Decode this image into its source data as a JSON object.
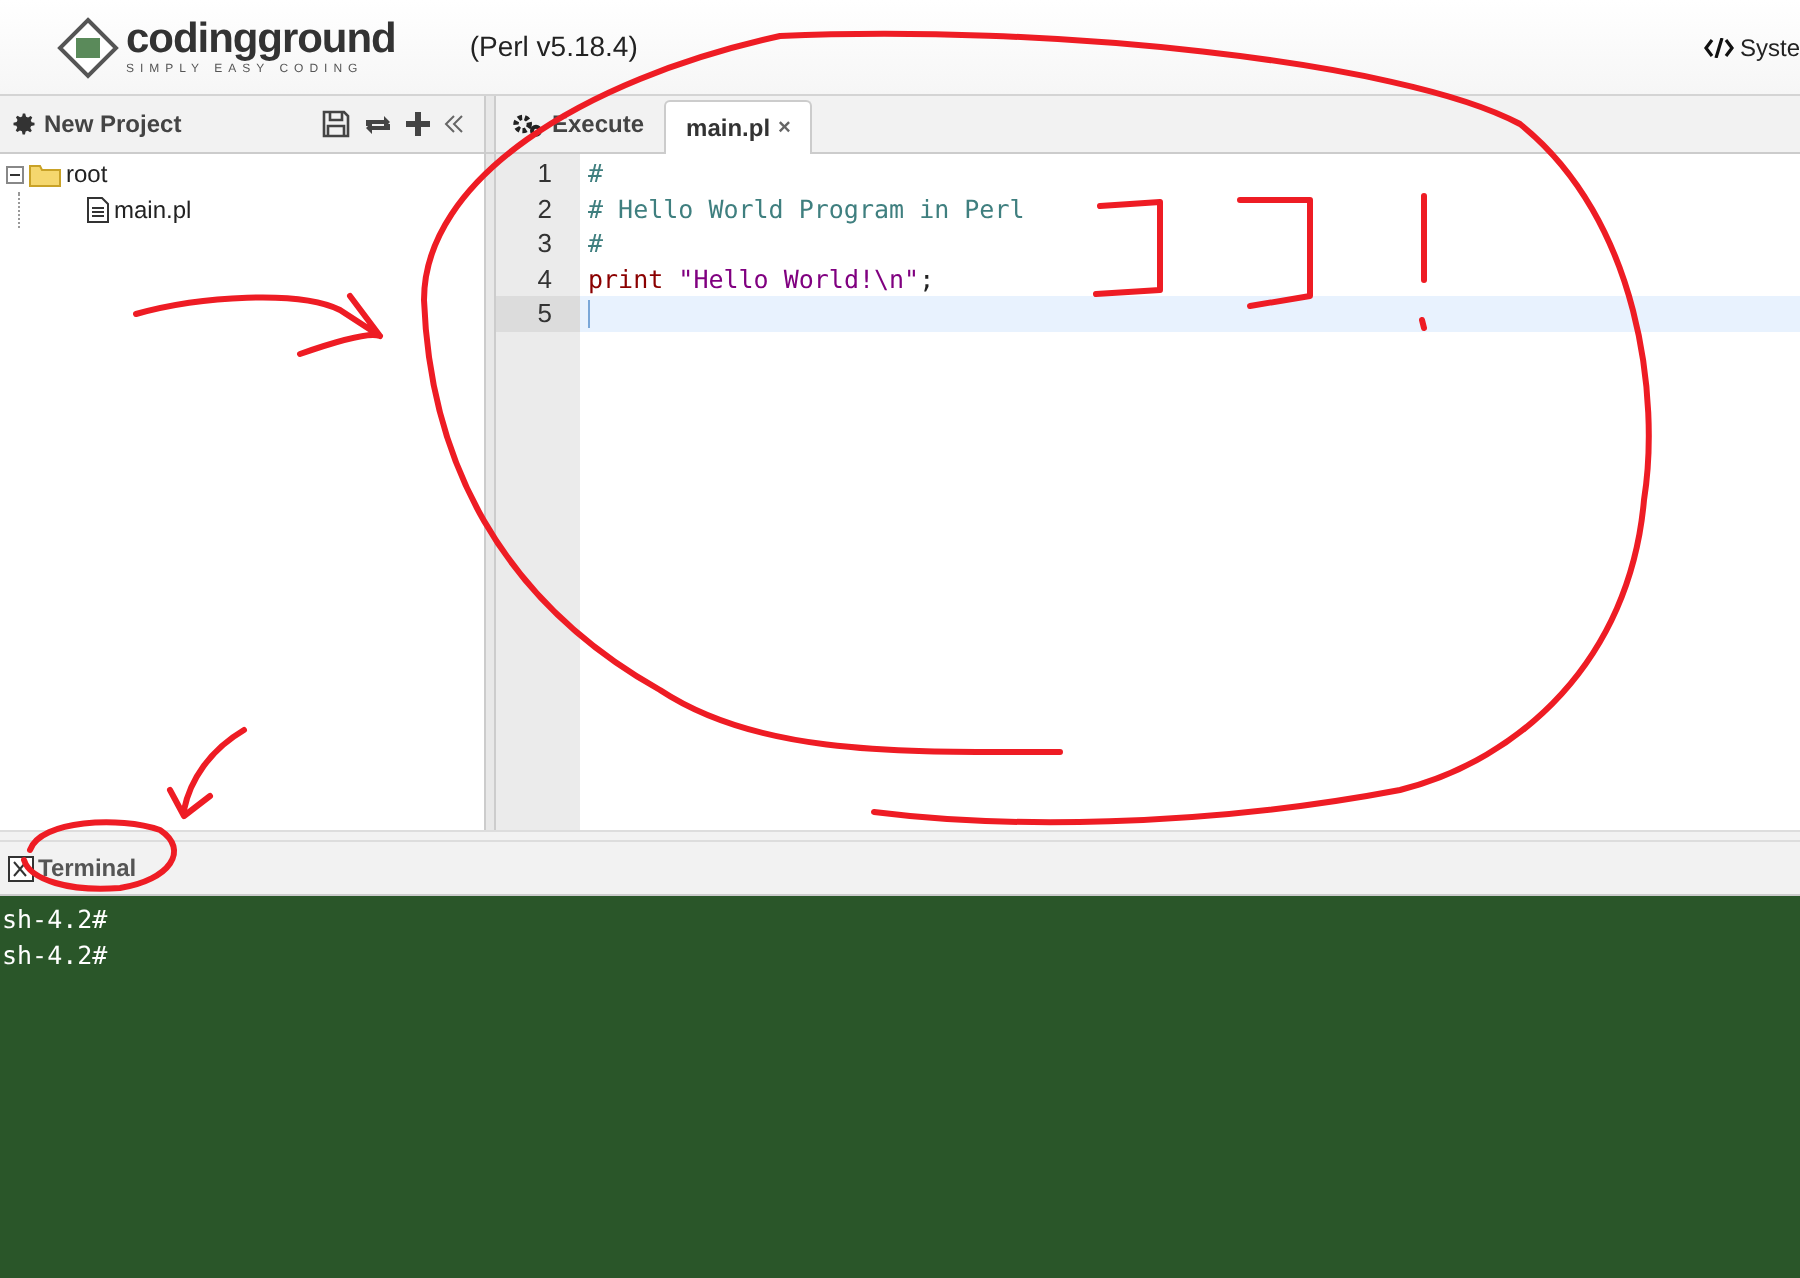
{
  "header": {
    "logo_name": "codingground",
    "logo_tagline": "SIMPLY EASY CODING",
    "version": "(Perl v5.18.4)",
    "system_link": "Syste"
  },
  "project_panel": {
    "title": "New Project",
    "tree": [
      {
        "label": "root",
        "kind": "folder",
        "expanded": true,
        "children": [
          {
            "label": "main.pl",
            "kind": "file"
          }
        ]
      }
    ]
  },
  "editor": {
    "execute_button": "Execute",
    "tabs": [
      {
        "label": "main.pl",
        "close": "×",
        "selected": true
      }
    ],
    "lines": [
      {
        "number": "1",
        "active": false,
        "tokens": [
          {
            "kind": "comment",
            "text": "#"
          }
        ]
      },
      {
        "number": "2",
        "active": false,
        "tokens": [
          {
            "kind": "comment",
            "text": "# Hello World Program in Perl"
          }
        ]
      },
      {
        "number": "3",
        "active": false,
        "tokens": [
          {
            "kind": "comment",
            "text": "#"
          }
        ]
      },
      {
        "number": "4",
        "active": false,
        "tokens": [
          {
            "kind": "keyword",
            "text": "print"
          },
          {
            "kind": "string",
            "text": " \"Hello World!\\n\""
          },
          {
            "kind": "plain",
            "text": ";"
          }
        ]
      },
      {
        "number": "5",
        "active": true
      }
    ]
  },
  "terminal": {
    "title": "Terminal",
    "lines": [
      "sh-4.2#",
      "sh-4.2#"
    ]
  }
}
